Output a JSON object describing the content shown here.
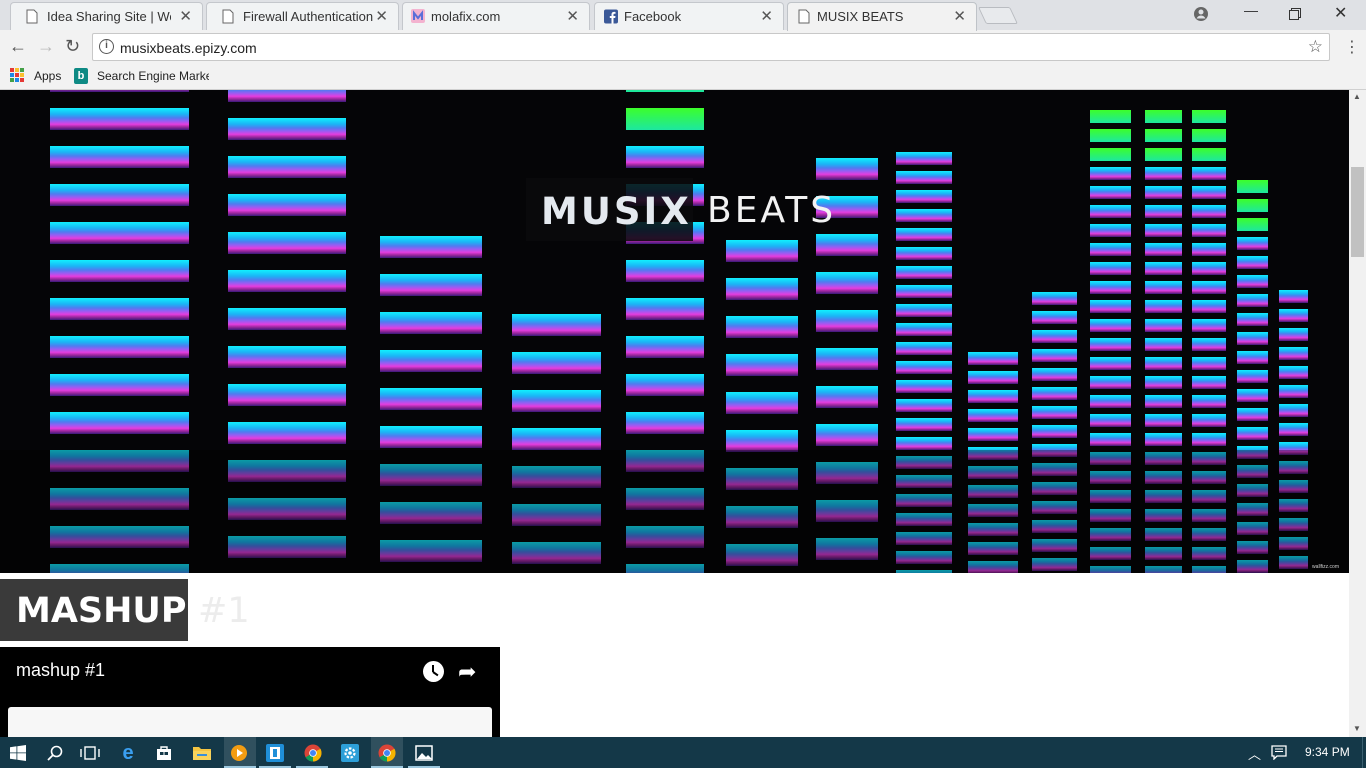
{
  "browser": {
    "tabs": [
      {
        "title": "Idea Sharing Site | Welco",
        "favicon": "page-icon",
        "active": false
      },
      {
        "title": "Firewall Authentication",
        "favicon": "page-icon",
        "active": false
      },
      {
        "title": "molafix.com",
        "favicon": "molafix-icon",
        "active": false
      },
      {
        "title": "Facebook",
        "favicon": "facebook-icon",
        "active": false
      },
      {
        "title": "MUSIX BEATS",
        "favicon": "page-icon",
        "active": true
      }
    ],
    "url": "musixbeats.epizy.com",
    "bookmarks": {
      "apps": "Apps",
      "search_engine": "Search Engine Marke"
    }
  },
  "page": {
    "logo": {
      "word1": "MUSIX",
      "word2": "BEATS"
    },
    "hero_credit": "wallfizz.com",
    "section": {
      "title": "MASHUP",
      "number": "#1"
    },
    "player": {
      "title": "mashup #1"
    }
  },
  "taskbar": {
    "time": "9:34 PM",
    "pinned": [
      "start-icon",
      "search-icon",
      "task-view-icon",
      "edge-icon",
      "store-icon",
      "file-explorer-icon",
      "media-player-icon",
      "app-icon",
      "chrome-icon",
      "settings-icon",
      "chrome-icon",
      "photos-icon"
    ]
  },
  "colors": {
    "tab_strip": "#dfe1e5",
    "hero_bg": "#050507",
    "taskbar": "#143848",
    "section_box": "#3a3a3a"
  }
}
